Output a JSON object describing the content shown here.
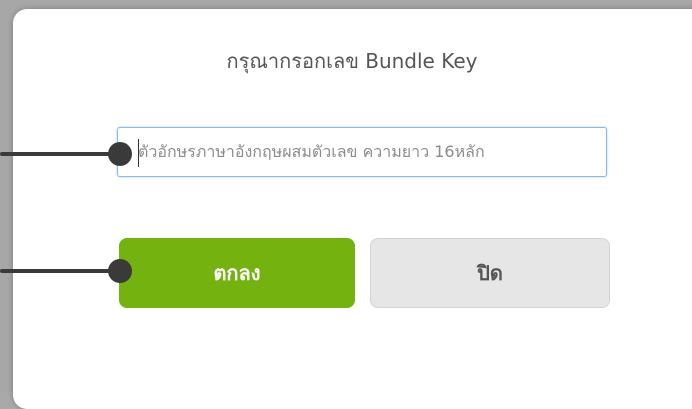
{
  "dialog": {
    "title": "กรุณากรอกเลข Bundle Key",
    "input": {
      "value": "",
      "placeholder": "ตัวอักษรภาษาอังกฤษผสมตัวเลข ความยาว 16หลัก"
    },
    "buttons": {
      "ok_label": "ตกลง",
      "close_label": "ปิด"
    }
  },
  "colors": {
    "ok_button": "#74b20f",
    "close_button": "#e6e6e6",
    "input_border": "#8fb8e6",
    "backdrop": "#a7a7a7",
    "pointer": "#3a3a3a"
  },
  "annotations": {
    "pointer_targets": [
      "bundle-key-input",
      "ok-button"
    ]
  }
}
